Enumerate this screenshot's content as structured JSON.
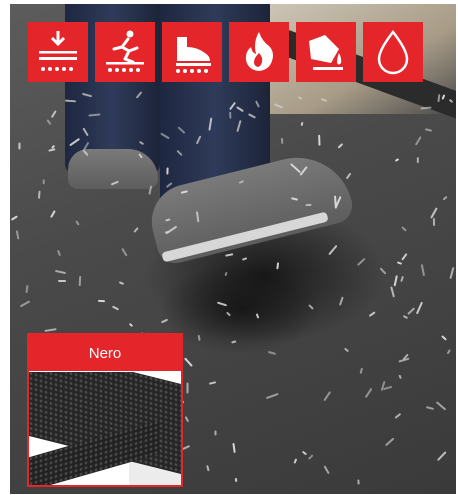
{
  "brand_color": "#e4262b",
  "icons": [
    {
      "name": "anti-fatigue-icon"
    },
    {
      "name": "anti-slip-icon"
    },
    {
      "name": "safety-shoe-icon"
    },
    {
      "name": "fire-resistant-icon"
    },
    {
      "name": "chemical-resistant-icon"
    },
    {
      "name": "water-resistant-icon"
    }
  ],
  "swatch": {
    "label": "Nero",
    "color": "#2a2a2a"
  }
}
